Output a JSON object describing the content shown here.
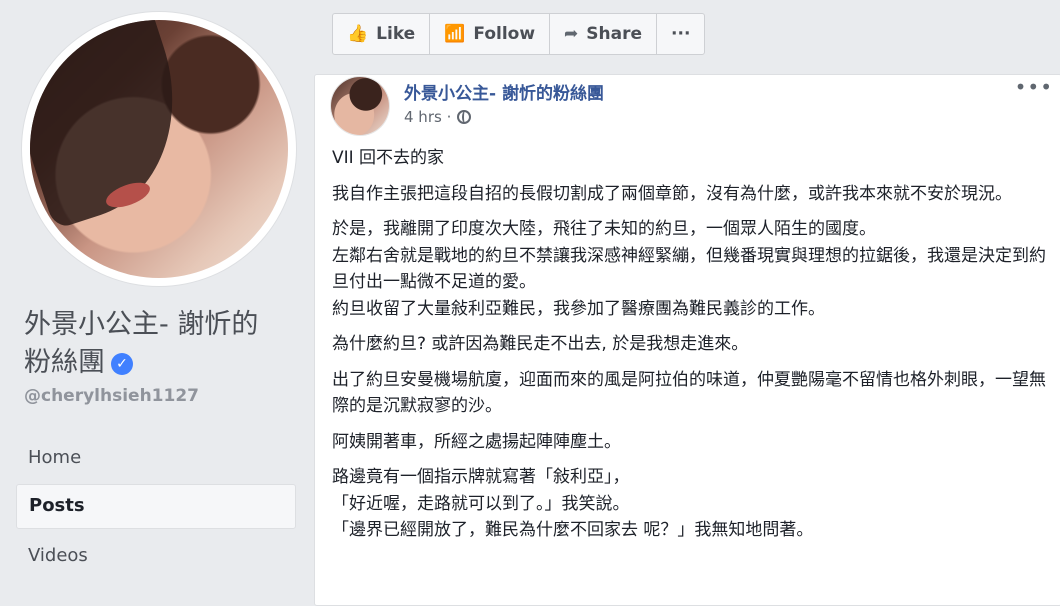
{
  "page": {
    "name": "外景小公主- 謝忻的粉絲團",
    "name_line1": "外景小公主- 謝忻的",
    "name_line2": "粉絲團",
    "handle": "@cherylhsieh1127",
    "verified_icon": "verified-check-icon"
  },
  "nav": [
    {
      "label": "Home"
    },
    {
      "label": "Posts"
    },
    {
      "label": "Videos"
    }
  ],
  "actions": {
    "like": "Like",
    "follow": "Follow",
    "share": "Share",
    "more": "···"
  },
  "post": {
    "author": "外景小公主- 謝忻的粉絲團",
    "time": "4 hrs",
    "more": "•••",
    "paragraphs": [
      "VII 回不去的家",
      "我自作主張把這段自招的長假切割成了兩個章節，沒有為什麼，或許我本來就不安於現況。",
      "於是，我離開了印度次大陸，飛往了未知的約旦，一個眾人陌生的國度。",
      "左鄰右舍就是戰地的約旦不禁讓我深感神經緊繃，但幾番現實與理想的拉鋸後，我還是決定到約旦付出一點微不足道的愛。",
      "約旦收留了大量敍利亞難民，我參加了醫療團為難民義診的工作。",
      "為什麼約旦? 或許因為難民走不出去, 於是我想走進來。",
      "出了約旦安曼機場航廈，迎面而來的風是阿拉伯的味道，仲夏艷陽毫不留情也格外刺眼，一望無際的是沉默寂寥的沙。",
      "阿姨開著車，所經之處揚起陣陣塵土。",
      "路邊竟有一個指示牌就寫著「敍利亞」，",
      "「好近喔，走路就可以到了。」我笑說。",
      "「邊界已經開放了，難民為什麼不回家去 呢？」我無知地問著。"
    ]
  },
  "colors": {
    "link": "#385898",
    "verified": "#4080ff",
    "background": "#e9ebee"
  }
}
